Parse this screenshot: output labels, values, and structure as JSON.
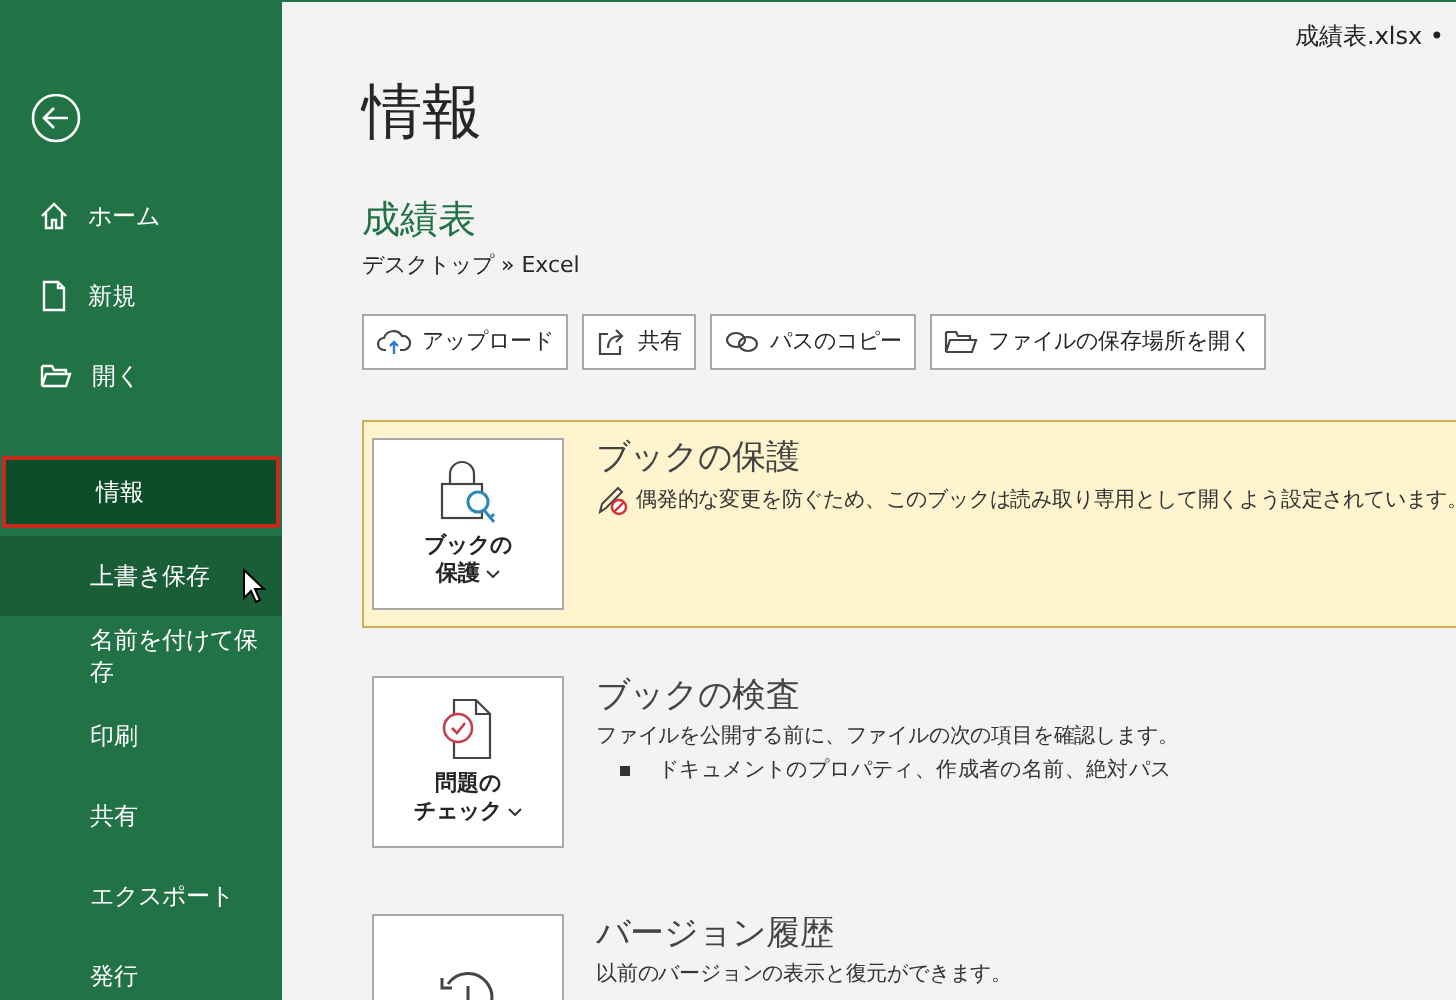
{
  "file_title": "成績表.xlsx •",
  "sidebar": {
    "top_items": [
      {
        "label": "ホーム",
        "selected": false,
        "hovered": false
      },
      {
        "label": "新規",
        "selected": false,
        "hovered": false
      },
      {
        "label": "開く",
        "selected": false,
        "hovered": false
      }
    ],
    "items": [
      {
        "label": "情報",
        "selected": true,
        "hovered": false
      },
      {
        "label": "上書き保存",
        "selected": false,
        "hovered": true
      },
      {
        "label": "名前を付けて保存",
        "selected": false,
        "hovered": false
      },
      {
        "label": "印刷",
        "selected": false,
        "hovered": false
      },
      {
        "label": "共有",
        "selected": false,
        "hovered": false
      },
      {
        "label": "エクスポート",
        "selected": false,
        "hovered": false
      },
      {
        "label": "発行",
        "selected": false,
        "hovered": false
      }
    ]
  },
  "page_title": "情報",
  "document": {
    "name": "成績表",
    "path": "デスクトップ » Excel"
  },
  "actions": [
    {
      "label": "アップロード"
    },
    {
      "label": "共有"
    },
    {
      "label": "パスのコピー"
    },
    {
      "label": "ファイルの保存場所を開く"
    }
  ],
  "sections": [
    {
      "tile": [
        "ブックの",
        "保護"
      ],
      "highlighted": true,
      "title": "ブックの保護",
      "description": "偶発的な変更を防ぐため、このブックは読み取り専用として開くよう設定されています。",
      "warning": true
    },
    {
      "tile": [
        "問題の",
        "チェック"
      ],
      "highlighted": false,
      "title": "ブックの検査",
      "description": "ファイルを公開する前に、ファイルの次の項目を確認します。",
      "bullets": [
        "ドキュメントのプロパティ、作成者の名前、絶対パス"
      ]
    },
    {
      "highlighted": false,
      "title": "バージョン履歴",
      "description": "以前のバージョンの表示と復元ができます。"
    }
  ]
}
